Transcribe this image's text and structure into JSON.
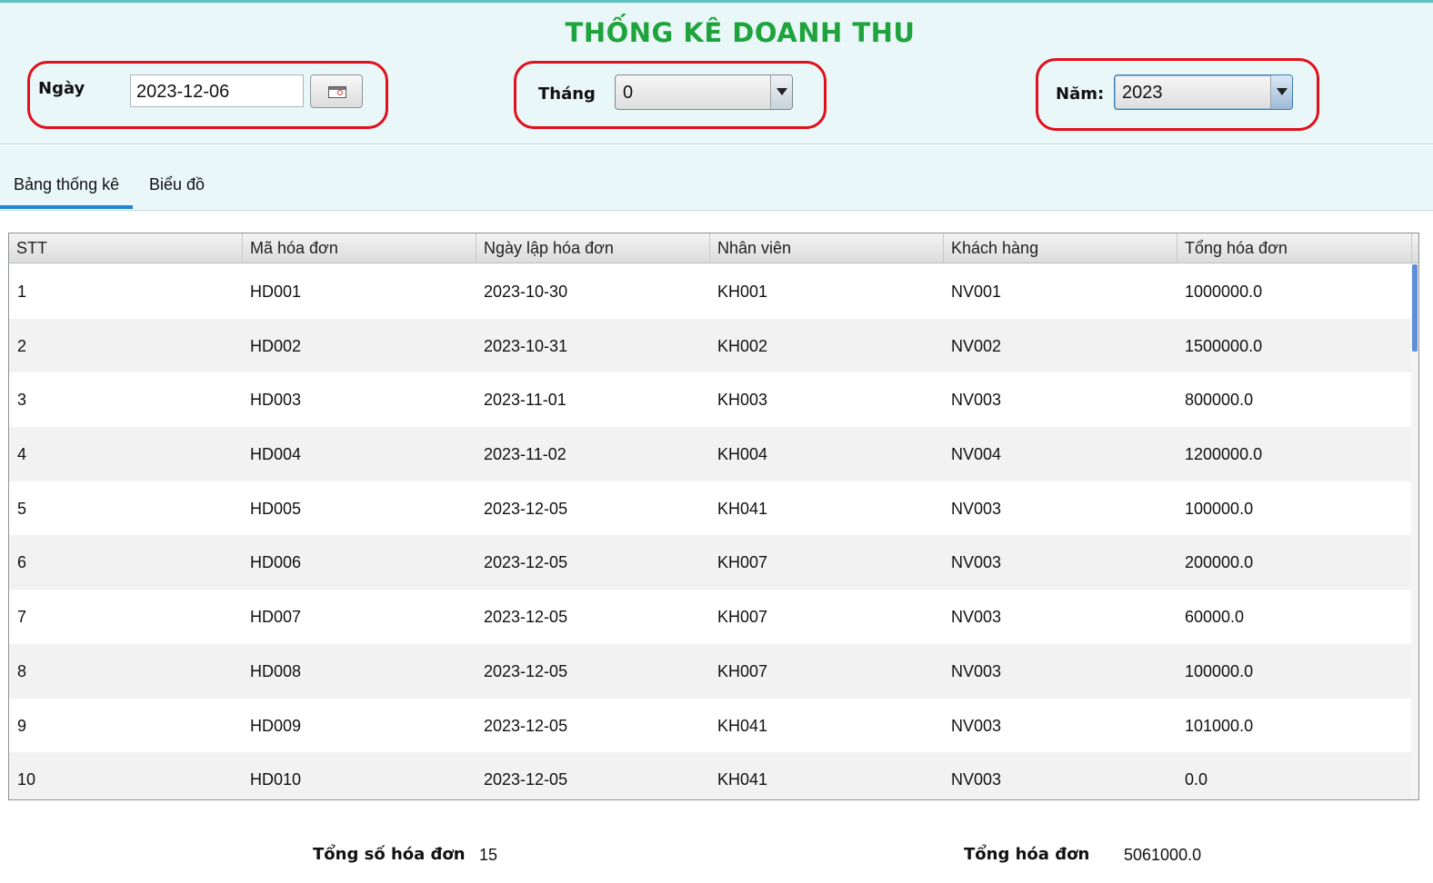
{
  "header": {
    "title": "THỐNG KÊ DOANH THU",
    "day": {
      "label": "Ngày",
      "value": "2023-12-06"
    },
    "month": {
      "label": "Tháng",
      "value": "0"
    },
    "year": {
      "label": "Năm:",
      "value": "2023"
    }
  },
  "tabs": [
    {
      "label": "Bảng thống kê",
      "selected": true
    },
    {
      "label": "Biểu đồ",
      "selected": false
    }
  ],
  "table": {
    "columns": [
      "STT",
      "Mã hóa đơn",
      "Ngày lập hóa đơn",
      "Nhân viên",
      "Khách hàng",
      "Tổng hóa đơn"
    ],
    "rows": [
      [
        "1",
        "HD001",
        "2023-10-30",
        "KH001",
        "NV001",
        "1000000.0"
      ],
      [
        "2",
        "HD002",
        "2023-10-31",
        "KH002",
        "NV002",
        "1500000.0"
      ],
      [
        "3",
        "HD003",
        "2023-11-01",
        "KH003",
        "NV003",
        "800000.0"
      ],
      [
        "4",
        "HD004",
        "2023-11-02",
        "KH004",
        "NV004",
        "1200000.0"
      ],
      [
        "5",
        "HD005",
        "2023-12-05",
        "KH041",
        "NV003",
        "100000.0"
      ],
      [
        "6",
        "HD006",
        "2023-12-05",
        "KH007",
        "NV003",
        "200000.0"
      ],
      [
        "7",
        "HD007",
        "2023-12-05",
        "KH007",
        "NV003",
        "60000.0"
      ],
      [
        "8",
        "HD008",
        "2023-12-05",
        "KH007",
        "NV003",
        "100000.0"
      ],
      [
        "9",
        "HD009",
        "2023-12-05",
        "KH041",
        "NV003",
        "101000.0"
      ],
      [
        "10",
        "HD010",
        "2023-12-05",
        "KH041",
        "NV003",
        "0.0"
      ]
    ]
  },
  "footer": {
    "count_label": "Tổng số hóa đơn",
    "count_value": "15",
    "total_label": "Tổng hóa đơn",
    "total_value": "5061000.0"
  },
  "colors": {
    "title": "#1fa43d",
    "highlight_ring": "#e0101c",
    "header_bg": "#eaf7f8",
    "tab_underline": "#1f86d6",
    "scrollbar_thumb": "#5f8fd8"
  },
  "icons": {
    "calendar_button": "calendar-icon",
    "dropdown": "chevron-down-icon"
  }
}
